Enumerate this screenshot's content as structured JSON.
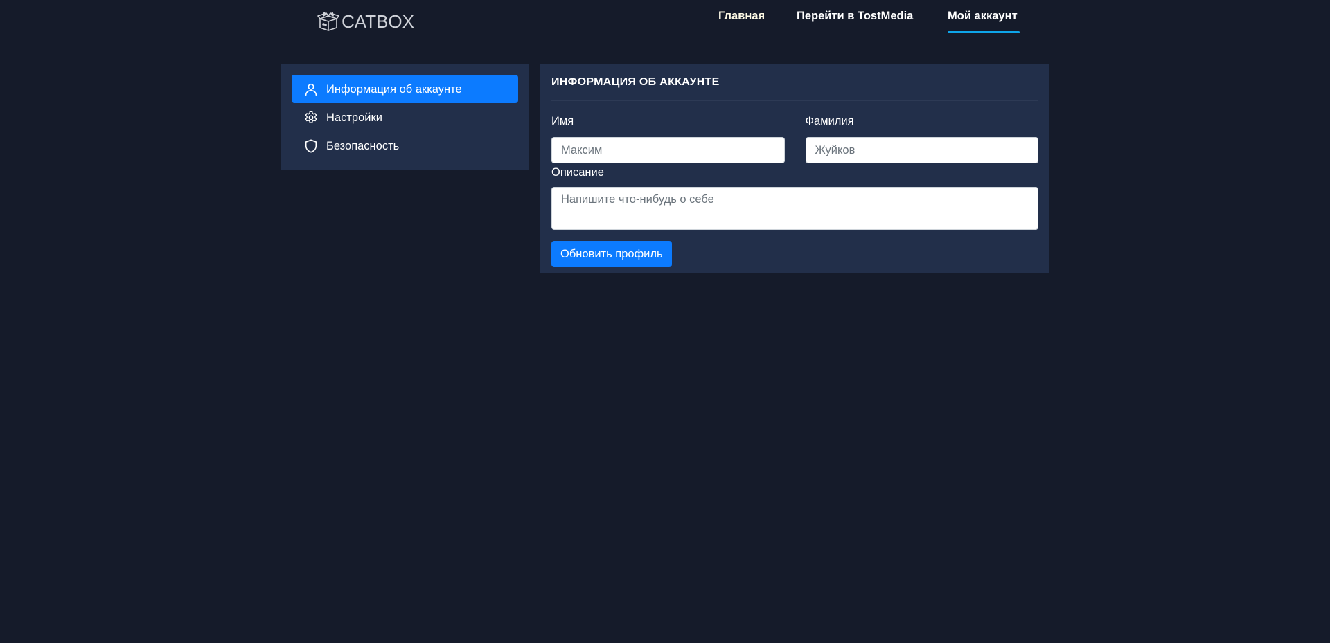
{
  "header": {
    "logo_text": "CATBOX",
    "nav": [
      {
        "label": "Главная"
      },
      {
        "label": "Перейти в TostMedia"
      },
      {
        "label": "Мой аккаунт"
      }
    ],
    "active_nav": "Мой аккаунт"
  },
  "sidebar": {
    "items": [
      {
        "label": "Информация об аккаунте",
        "icon": "user-icon",
        "active": true
      },
      {
        "label": "Настройки",
        "icon": "gear-icon",
        "active": false
      },
      {
        "label": "Безопасность",
        "icon": "shield-icon",
        "active": false
      }
    ]
  },
  "panel": {
    "title": "ИНФОРМАЦИЯ ОБ АККАУНТЕ",
    "first_name": {
      "label": "Имя",
      "placeholder": "Максим",
      "value": ""
    },
    "last_name": {
      "label": "Фамилия",
      "placeholder": "Жуйков",
      "value": ""
    },
    "description": {
      "label": "Описание",
      "placeholder": "Напишите что-нибудь о себе",
      "value": ""
    },
    "submit_label": "Обновить профиль"
  },
  "colors": {
    "background": "#151b2a",
    "panel": "#222f4a",
    "accent": "#0c7bff",
    "nav_underline": "#0ea5e9"
  }
}
